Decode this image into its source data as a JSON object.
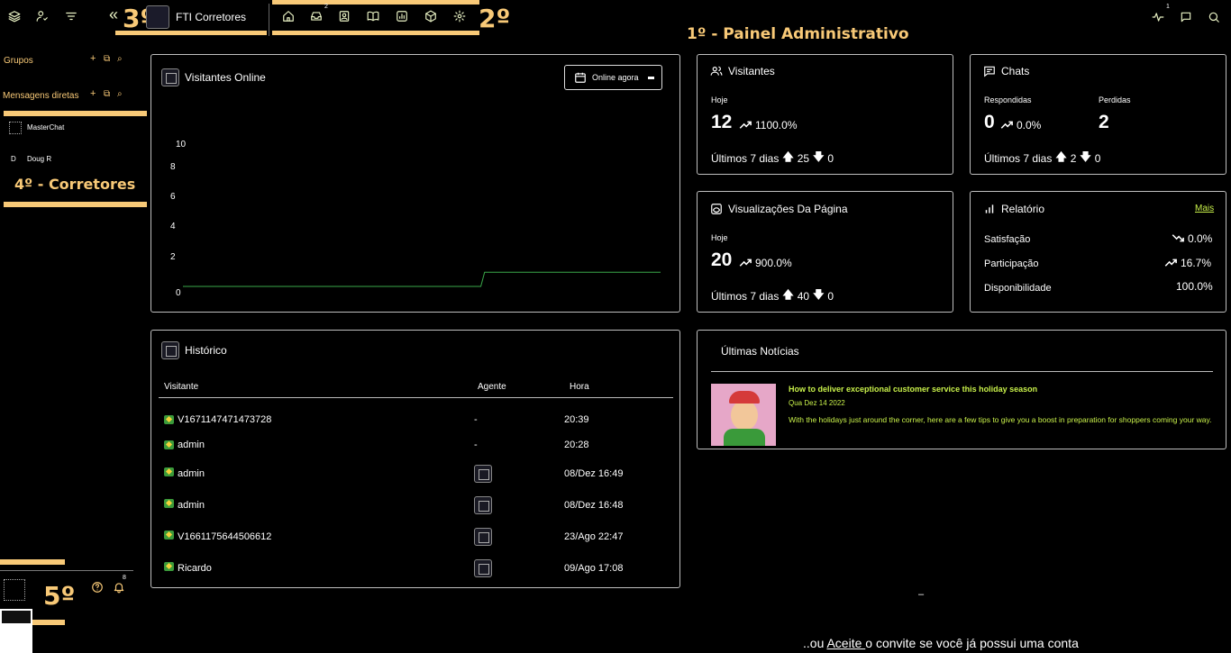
{
  "topbar": {
    "app_name": "FTI Corretores",
    "notification_badge_inbox": "2",
    "activity_badge": "1",
    "annotation_step_3": "3º",
    "annotation_step_2": "2º"
  },
  "dashboard_title": "1º - Painel Administrativo",
  "sidebar": {
    "groups_label": "Grupos",
    "direct_messages_label": "Mensagens diretas",
    "contacts": [
      {
        "name": "MasterChat"
      },
      {
        "name": "Doug R"
      }
    ],
    "annotation_step_4": "4º - Corretores",
    "annotation_step_5": "5º",
    "bell_badge": "8"
  },
  "visitors_online": {
    "title": "Visitantes Online",
    "filter_label": "Online agora",
    "chart_data": {
      "type": "line",
      "y_ticks": [
        "10",
        "8",
        "6",
        "4",
        "2",
        "0"
      ],
      "ylim": [
        0,
        10
      ],
      "series": [
        {
          "values": [
            0,
            0,
            0,
            0,
            0,
            0,
            0,
            0,
            0,
            0,
            0,
            0,
            1,
            1,
            1,
            1,
            1,
            1,
            1,
            1
          ]
        }
      ],
      "color": "#3aa84a"
    }
  },
  "visitors_card": {
    "title": "Visitantes",
    "today_label": "Hoje",
    "today_value": "12",
    "growth": "1100.0%",
    "week_label": "Últimos 7 dias",
    "week_up": "25",
    "week_down": "0"
  },
  "chats_card": {
    "title": "Chats",
    "answered_label": "Respondidas",
    "answered_value": "0",
    "answered_growth": "0.0%",
    "lost_label": "Perdidas",
    "lost_value": "2",
    "week_label": "Últimos 7 dias",
    "week_up": "2",
    "week_down": "0"
  },
  "pageviews_card": {
    "title": "Visualizações Da Página",
    "today_label": "Hoje",
    "today_value": "20",
    "growth": "900.0%",
    "week_label": "Últimos 7 dias",
    "week_up": "40",
    "week_down": "0"
  },
  "report_card": {
    "title": "Relatório",
    "more_link": "Mais",
    "rows": [
      {
        "label": "Satisfação",
        "value": "0.0%"
      },
      {
        "label": "Participação",
        "value": "16.7%"
      },
      {
        "label": "Disponibilidade",
        "value": "100.0%"
      }
    ]
  },
  "history": {
    "title": "Histórico",
    "columns": [
      "Visitante",
      "Agente",
      "Hora"
    ],
    "rows": [
      {
        "visitor": "V1671147471473728",
        "agent": "-",
        "time": "20:39"
      },
      {
        "visitor": "admin",
        "agent": "-",
        "time": "20:28"
      },
      {
        "visitor": "admin",
        "agent": "",
        "time": "08/Dez 16:49"
      },
      {
        "visitor": "admin",
        "agent": "",
        "time": "08/Dez 16:48"
      },
      {
        "visitor": "V1661175644506612",
        "agent": "",
        "time": "23/Ago 22:47"
      },
      {
        "visitor": "Ricardo",
        "agent": "",
        "time": "09/Ago 17:08"
      }
    ]
  },
  "news": {
    "title": "Últimas Notícias",
    "item": {
      "headline": "How to deliver exceptional customer service this holiday season",
      "date": "Qua Dez 14 2022",
      "summary": "With the holidays just around the corner, here are a few tips to give you a boost in preparation for shoppers coming your way."
    }
  },
  "footer": {
    "prefix": "..ou ",
    "link": "Aceite ",
    "suffix": "o convite se você já possui uma conta",
    "dash": "–"
  },
  "colors": {
    "accent": "#f8c977",
    "news_green": "#c8f04a",
    "chart_line": "#3aa84a"
  }
}
